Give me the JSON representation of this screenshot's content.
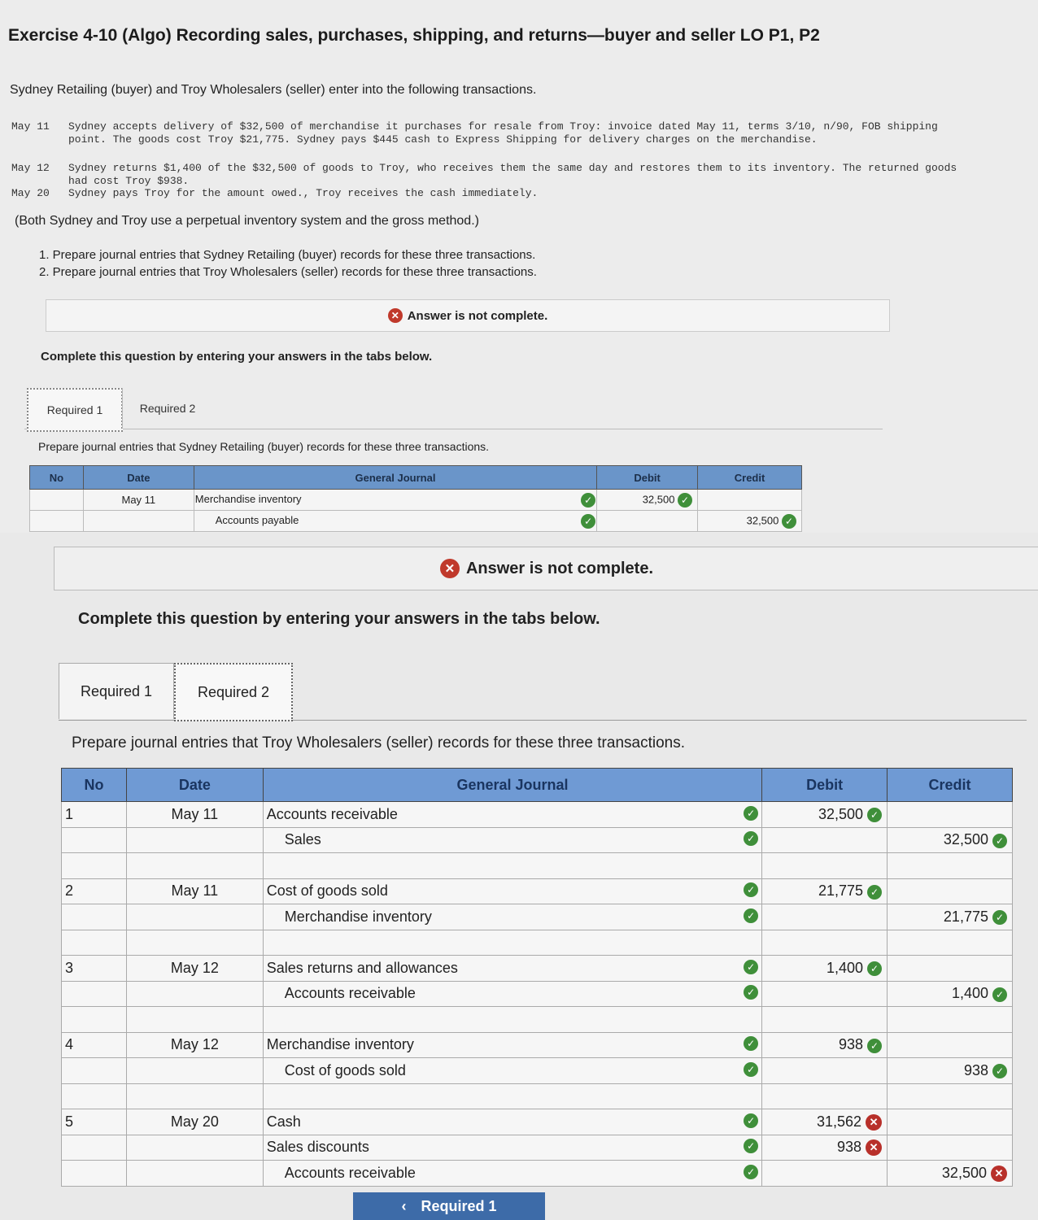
{
  "title": "Exercise 4-10 (Algo) Recording sales, purchases, shipping, and returns—buyer and seller LO P1, P2",
  "intro": "Sydney Retailing (buyer) and Troy Wholesalers (seller) enter into the following transactions.",
  "transactions": [
    {
      "date": "May 11",
      "text": "Sydney accepts delivery of $32,500 of merchandise it purchases for resale from Troy: invoice dated May 11, terms 3/10, n/90, FOB shipping point. The goods cost Troy $21,775. Sydney pays $445 cash to Express Shipping for delivery charges on the merchandise."
    },
    {
      "date": "May 12",
      "text": "Sydney returns $1,400 of the $32,500 of goods to Troy, who receives them the same day and restores them to its inventory. The returned goods had cost Troy $938."
    },
    {
      "date": "May 20",
      "text": "Sydney pays Troy for the amount owed., Troy receives the cash immediately."
    }
  ],
  "note": "(Both Sydney and Troy use a perpetual inventory system and the gross method.)",
  "requirements": [
    "1. Prepare journal entries that Sydney Retailing (buyer) records for these three transactions.",
    "2. Prepare journal entries that Troy Wholesalers (seller) records for these three transactions."
  ],
  "banner": "Answer is not complete.",
  "complete_msg": "Complete this question by entering your answers in the tabs below.",
  "tabs": [
    "Required 1",
    "Required 2"
  ],
  "part1": {
    "instruction": "Prepare journal entries that Sydney Retailing (buyer) records for these three transactions.",
    "headers": [
      "No",
      "Date",
      "General Journal",
      "Debit",
      "Credit"
    ],
    "rows": [
      {
        "no": "",
        "date": "May 11",
        "account": "Merchandise inventory",
        "debit": "32,500",
        "credit": ""
      },
      {
        "no": "",
        "date": "",
        "account": "Accounts payable",
        "debit": "",
        "credit": "32,500"
      }
    ]
  },
  "part2": {
    "instruction": "Prepare journal entries that Troy Wholesalers (seller) records for these three transactions.",
    "headers": [
      "No",
      "Date",
      "General Journal",
      "Debit",
      "Credit"
    ],
    "rows": [
      {
        "no": "1",
        "date": "May 11",
        "account": "Accounts receivable",
        "debit": "32,500",
        "credit": ""
      },
      {
        "no": "",
        "date": "",
        "account": "Sales",
        "debit": "",
        "credit": "32,500"
      },
      {
        "no": "2",
        "date": "May 11",
        "account": "Cost of goods sold",
        "debit": "21,775",
        "credit": ""
      },
      {
        "no": "",
        "date": "",
        "account": "Merchandise inventory",
        "debit": "",
        "credit": "21,775"
      },
      {
        "no": "3",
        "date": "May 12",
        "account": "Sales returns and allowances",
        "debit": "1,400",
        "credit": ""
      },
      {
        "no": "",
        "date": "",
        "account": "Accounts receivable",
        "debit": "",
        "credit": "1,400"
      },
      {
        "no": "4",
        "date": "May 12",
        "account": "Merchandise inventory",
        "debit": "938",
        "credit": ""
      },
      {
        "no": "",
        "date": "",
        "account": "Cost of goods sold",
        "debit": "",
        "credit": "938"
      },
      {
        "no": "5",
        "date": "May 20",
        "account": "Cash",
        "debit": "31,562",
        "credit": ""
      },
      {
        "no": "",
        "date": "",
        "account": "Sales discounts",
        "debit": "938",
        "credit": ""
      },
      {
        "no": "",
        "date": "",
        "account": "Accounts receivable",
        "debit": "",
        "credit": "32,500"
      }
    ]
  },
  "nav_button": "Required 1"
}
